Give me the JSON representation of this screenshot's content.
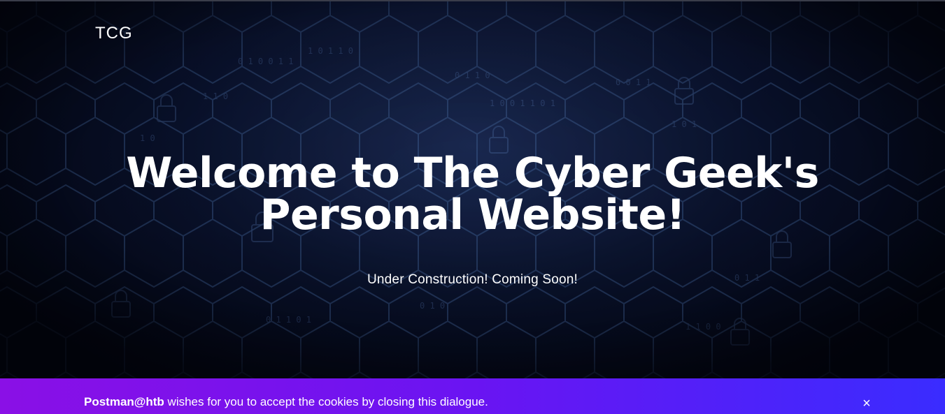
{
  "header": {
    "brand": "TCG"
  },
  "hero": {
    "title_line1": "Welcome to The Cyber Geek's",
    "title_line2": "Personal Website!",
    "subtitle": "Under Construction! Coming Soon!"
  },
  "cookie_banner": {
    "sender": "Postman@htb",
    "message": " wishes for you to accept the cookies by closing this dialogue.",
    "close_glyph": "×"
  },
  "colors": {
    "background": "#05081a",
    "banner_start": "#8a10e6",
    "banner_end": "#3a2cff",
    "text": "#ffffff"
  },
  "icons": {
    "close": "close-icon"
  }
}
